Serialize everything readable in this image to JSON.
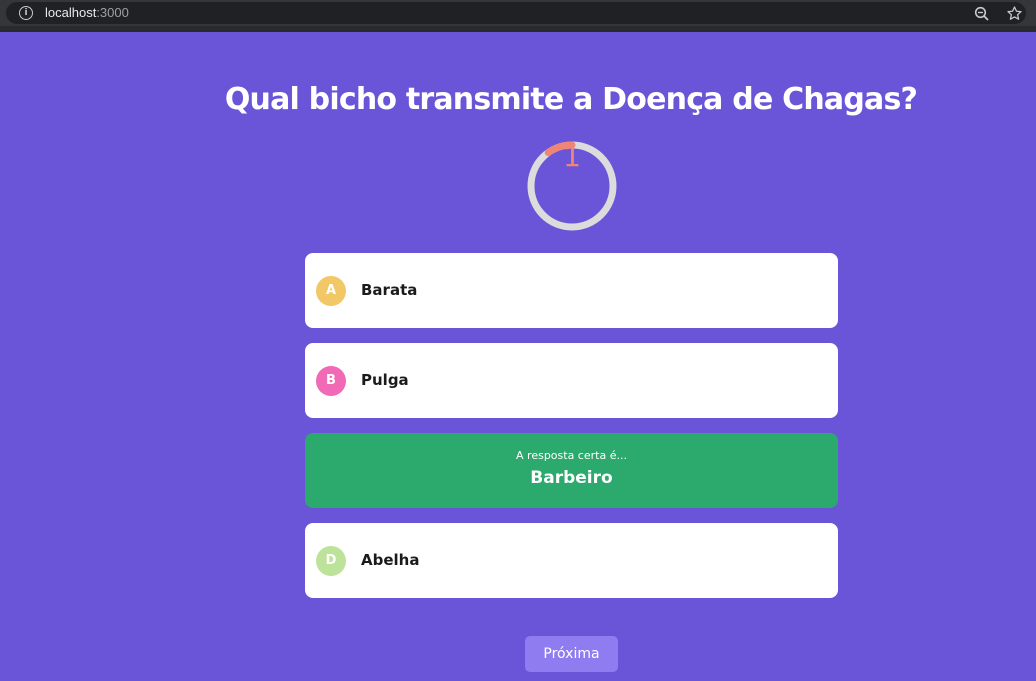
{
  "browser": {
    "url_host": "localhost",
    "url_port": ":3000"
  },
  "quiz": {
    "question": "Qual bicho transmite a Doença de Chagas?",
    "timer": {
      "value": "1",
      "remaining_fraction": 0.1,
      "track_color": "#dcdcdc",
      "progress_color": "#ee8577"
    },
    "options": [
      {
        "letter": "A",
        "text": "Barata",
        "badge_color": "#f2c766"
      },
      {
        "letter": "B",
        "text": "Pulga",
        "badge_color": "#f16ab5"
      },
      {
        "letter": "D",
        "text": "Abelha",
        "badge_color": "#bde39a"
      }
    ],
    "answer": {
      "caption": "A resposta certa é...",
      "value": "Barbeiro",
      "color": "#2ca96d"
    },
    "next_label": "Próxima"
  },
  "colors": {
    "background": "#6a55d9",
    "button": "#8e7cf0"
  }
}
